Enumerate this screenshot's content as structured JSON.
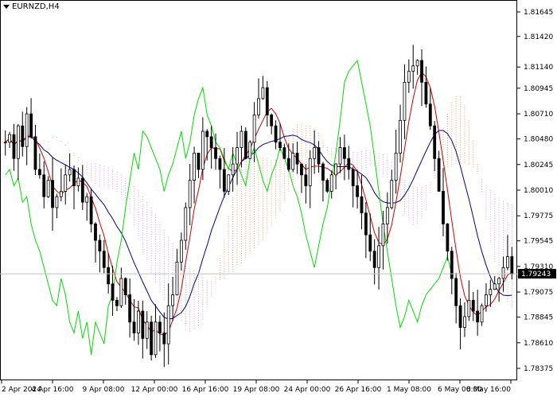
{
  "symbol": "EURNZD,H4",
  "price_tag": "1.79243",
  "colors": {
    "candle": "#000000",
    "tenkan": "#cc0000",
    "kijun": "#00008b",
    "chikou": "#00dd00",
    "kumo_bull": "#e8a070",
    "kumo_bear": "#c8a8c8",
    "grid": "#c0c0c0",
    "price_line": "#c0c0c0"
  },
  "chart_data": {
    "type": "candlestick",
    "indicator": "Ichimoku Kinko Hyo",
    "ylim": [
      1.78375,
      1.81645
    ],
    "y_ticks": [
      "1.81645",
      "1.81420",
      "1.81140",
      "1.80945",
      "1.80710",
      "1.80480",
      "1.80245",
      "1.80010",
      "1.79775",
      "1.79545",
      "1.79310",
      "1.79075",
      "1.78845",
      "1.78610",
      "1.78375"
    ],
    "x_ticks": [
      "2 Apr 2024",
      "4 Apr 16:00",
      "9 Apr 08:00",
      "12 Apr 00:00",
      "16 Apr 16:00",
      "19 Apr 08:00",
      "24 Apr 00:00",
      "26 Apr 16:00",
      "1 May 08:00",
      "6 May 00:00",
      "8 May 16:00"
    ],
    "current_price": 1.79243,
    "close_approx": [
      1.8045,
      1.8052,
      1.803,
      1.806,
      1.8041,
      1.8071,
      1.805,
      1.802,
      1.8015,
      1.7995,
      1.801,
      1.7985,
      1.7995,
      1.8,
      1.8015,
      1.802,
      1.8005,
      1.8012,
      1.799,
      1.7995,
      1.797,
      1.7955,
      1.7945,
      1.793,
      1.7915,
      1.79,
      1.7895,
      1.792,
      1.7905,
      1.788,
      1.787,
      1.789,
      1.7865,
      1.788,
      1.785,
      1.788,
      1.787,
      1.786,
      1.7895,
      1.7905,
      1.7935,
      1.7955,
      1.7985,
      1.801,
      1.8035,
      1.802,
      1.8055,
      1.805,
      1.804,
      1.803,
      1.802,
      1.8,
      1.8015,
      1.8025,
      1.804,
      1.8055,
      1.803,
      1.8045,
      1.807,
      1.8085,
      1.8095,
      1.807,
      1.806,
      1.8045,
      1.804,
      1.803,
      1.802,
      1.8035,
      1.8025,
      1.8015,
      1.8005,
      1.803,
      1.804,
      1.8025,
      1.801,
      1.8,
      1.8015,
      1.8025,
      1.804,
      1.803,
      1.802,
      1.8005,
      1.7995,
      1.798,
      1.796,
      1.7945,
      1.793,
      1.795,
      1.797,
      1.7985,
      1.801,
      1.8035,
      1.8065,
      1.81,
      1.811,
      1.8115,
      1.812,
      1.81,
      1.808,
      1.806,
      1.803,
      1.8,
      1.797,
      1.7945,
      1.792,
      1.7895,
      1.7875,
      1.7885,
      1.79,
      1.789,
      1.788,
      1.7895,
      1.7905,
      1.791,
      1.7915,
      1.792,
      1.793,
      1.794,
      1.7924
    ]
  }
}
